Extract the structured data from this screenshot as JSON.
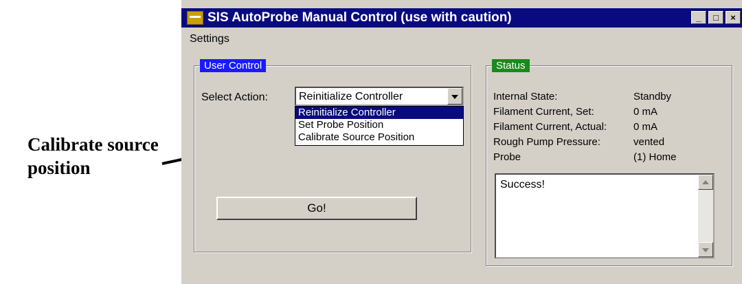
{
  "annotation": {
    "text": "Calibrate source position"
  },
  "window": {
    "title": "SIS AutoProbe Manual Control (use with caution)",
    "app_icon": "autoprobe-app-icon",
    "buttons": {
      "minimize": "_",
      "maximize": "□",
      "close": "×"
    },
    "menu": [
      "Settings"
    ]
  },
  "user_control": {
    "label": "User Control",
    "select_label": "Select Action:",
    "select_value": "Reinitialize Controller",
    "options": [
      "Reinitialize Controller",
      "Set Probe Position",
      "Calibrate Source Position"
    ],
    "go_label": "Go!"
  },
  "status": {
    "label": "Status",
    "rows": [
      {
        "key": "Internal State:",
        "value": "Standby"
      },
      {
        "key": "Filament Current, Set:",
        "value": "0 mA"
      },
      {
        "key": "Filament Current, Actual:",
        "value": "0 mA"
      },
      {
        "key": "Rough Pump Pressure:",
        "value": "vented"
      },
      {
        "key": "Probe",
        "value": "(1) Home"
      }
    ],
    "log": "Success!"
  },
  "colors": {
    "title_bar": "#0a0a80",
    "user_label": "#1a1aff",
    "status_label": "#1a8a1a"
  }
}
